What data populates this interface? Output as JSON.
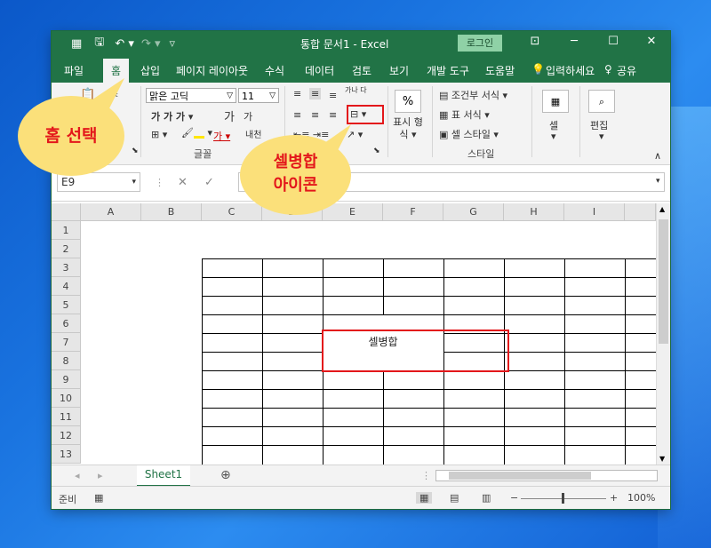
{
  "window": {
    "title": "통합 문서1  -  Excel",
    "login_label": "로그인",
    "minimize": "─",
    "restore": "☐",
    "close": "✕",
    "ribbon_display": "⊡"
  },
  "qat": {
    "save": "🖫",
    "undo": "↶ ▾",
    "redo": "↷ ▾",
    "customize": "▿",
    "app": "▦"
  },
  "tabs": [
    "파일",
    "홈",
    "삽입",
    "페이지 레이아웃",
    "수식",
    "데이터",
    "검토",
    "보기",
    "개발 도구",
    "도움말"
  ],
  "tell_me": "입력하세요",
  "share": "공유",
  "ribbon": {
    "font_name": "맑은 고딕",
    "font_size": "11",
    "bold_row": "가  가  가 ▾",
    "grow_font": "가",
    "shrink_font": "가",
    "phonetic": "내천",
    "wrap_text": "가나 다",
    "font_group": "글꼴",
    "percent": "%",
    "number_format": "표시 형식",
    "number_format_arrow": "▾",
    "cond_format": "조건부 서식 ▾",
    "table_format": "표 서식 ▾",
    "cell_style": "셀 스타일 ▾",
    "style_group": "스타일",
    "cells_label": "셀",
    "editing_label": "편집",
    "collapse": "∧"
  },
  "formula_bar": {
    "name_box": "E9",
    "cancel": "✕",
    "enter": "✓"
  },
  "columns": [
    "A",
    "B",
    "C",
    "D",
    "E",
    "F",
    "G",
    "H",
    "I"
  ],
  "rows": [
    "1",
    "2",
    "3",
    "4",
    "5",
    "6",
    "7",
    "8",
    "9",
    "10",
    "11",
    "12",
    "13"
  ],
  "merged_cell_text": "셀병합",
  "sheet_tabs": [
    "Sheet1"
  ],
  "add_sheet": "⊕",
  "status": {
    "ready": "준비",
    "zoom": "100%",
    "zoom_minus": "−",
    "zoom_plus": "+"
  },
  "callouts": {
    "home_select": "홈 선택",
    "merge_icon_line1": "셀병합",
    "merge_icon_line2": "아이콘"
  },
  "colors": {
    "excel_green": "#217346",
    "callout_yellow": "#fbe07a",
    "highlight_red": "#e3171b"
  }
}
